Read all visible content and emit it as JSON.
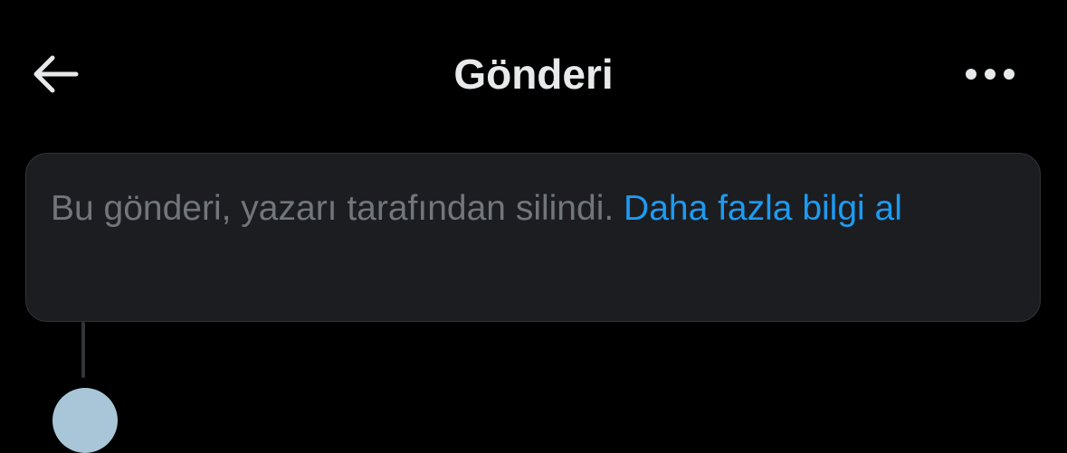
{
  "header": {
    "title": "Gönderi",
    "back_icon": "arrow-left-icon",
    "more_icon": "more-horizontal-icon"
  },
  "notice": {
    "text": "Bu gönderi, yazarı tarafından silindi.",
    "link_label": "Daha fazla bilgi al"
  },
  "colors": {
    "background": "#000000",
    "card_background": "#1c1d21",
    "muted_text": "#71767b",
    "link": "#1d9bf0",
    "title_text": "#e7e9ea"
  }
}
